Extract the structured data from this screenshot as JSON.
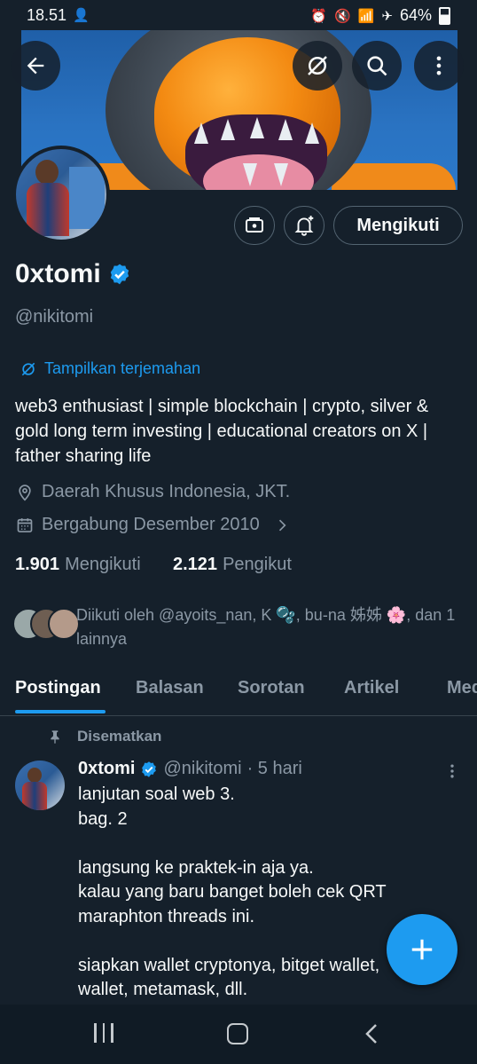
{
  "status_bar": {
    "time": "18.51",
    "battery": "64%"
  },
  "profile": {
    "display_name": "0xtomi",
    "handle": "@nikitomi",
    "translate_link": "Tampilkan terjemahan",
    "bio_lines": [
      "web3 enthusiast | simple blockchain | crypto, silver &",
      "gold long term investing | educational creators on X |",
      "father sharing life"
    ],
    "location": "Daerah Khusus Indonesia, JKT.",
    "joined": "Bergabung Desember 2010",
    "following_count": "1.901",
    "following_label": "Mengikuti",
    "followers_count": "2.121",
    "followers_label": "Pengikut",
    "followed_by_line1": "Diikuti oleh @ayoits_nan, K 🫧, bu-na 姊姊 🌸, dan 1",
    "followed_by_line2": "lainnya",
    "follow_button": "Mengikuti"
  },
  "tabs": [
    "Postingan",
    "Balasan",
    "Sorotan",
    "Artikel",
    "Media"
  ],
  "active_tab": 0,
  "pinned_post": {
    "pinned_label": "Disematkan",
    "author_name": "0xtomi",
    "author_handle": "@nikitomi",
    "time": "· 5 hari",
    "lines": [
      "lanjutan soal web 3.",
      "bag. 2",
      "",
      "langsung ke praktek-in aja ya.",
      "kalau yang baru banget boleh cek QRT",
      "maraphton threads ini.",
      "",
      "siapkan wallet cryptonya, bitget wallet,",
      "wallet, metamask, dll."
    ]
  },
  "colors": {
    "background": "#15202b",
    "accent": "#1d9bf0",
    "muted_text": "#8b98a5",
    "border": "#536471"
  },
  "icons": [
    "back-arrow-icon",
    "translate-icon",
    "search-icon",
    "more-vertical-icon",
    "wallet-icon",
    "bell-plus-icon",
    "verified-icon",
    "location-icon",
    "calendar-icon",
    "chevron-right-icon",
    "pin-icon",
    "plus-icon"
  ]
}
